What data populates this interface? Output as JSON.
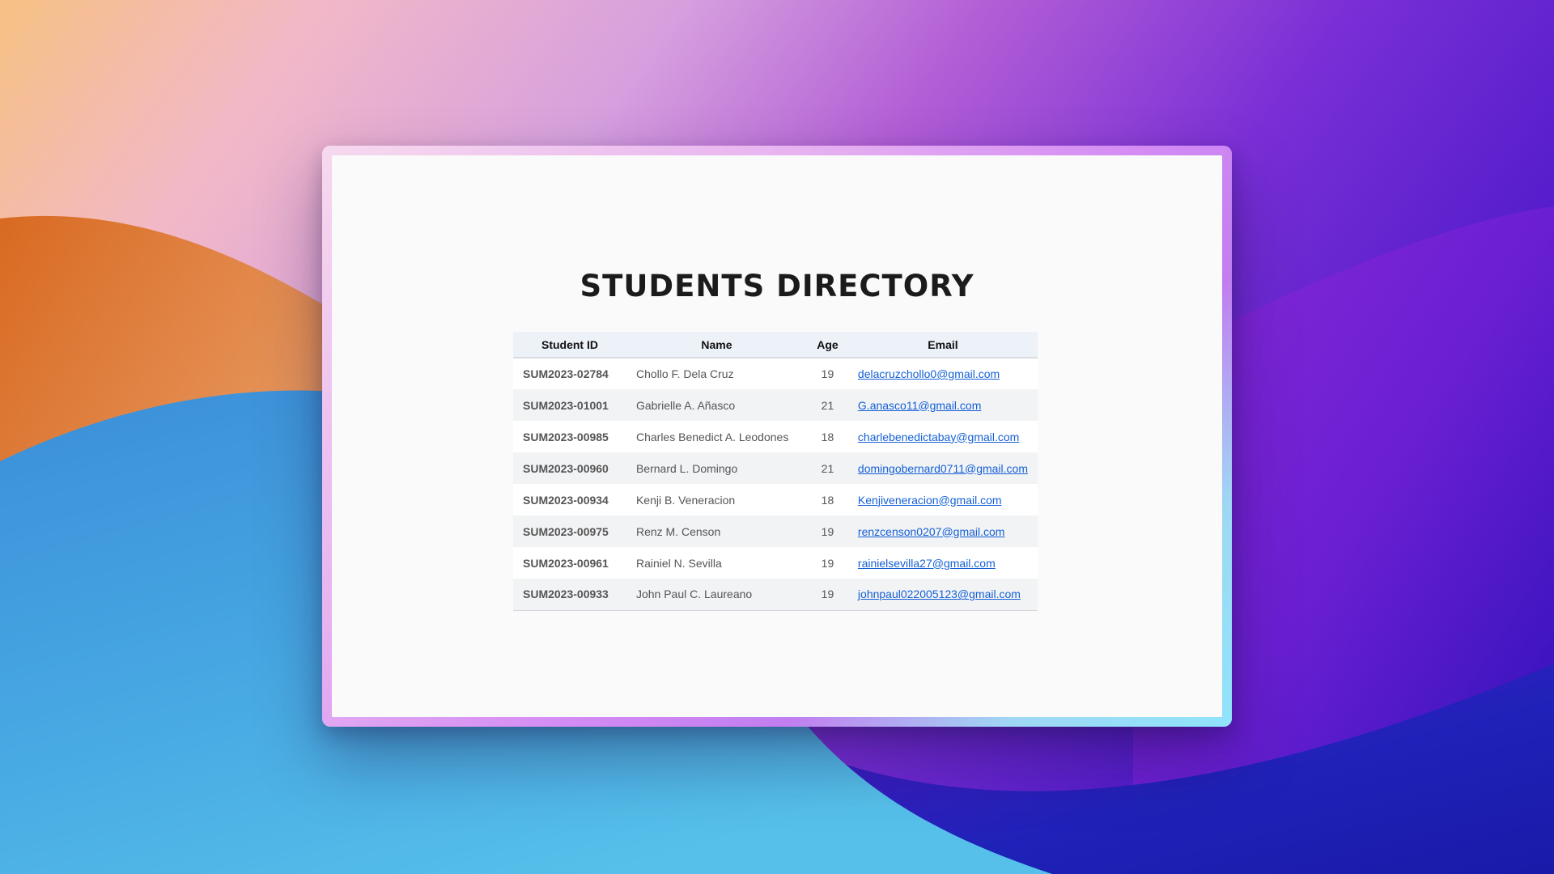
{
  "page": {
    "title": "STUDENTS DIRECTORY"
  },
  "table": {
    "headers": {
      "student_id": "Student ID",
      "name": "Name",
      "age": "Age",
      "email": "Email"
    },
    "rows": [
      {
        "student_id": "SUM2023-02784",
        "name": "Chollo F. Dela Cruz",
        "age": "19",
        "email": "delacruzchollo0@gmail.com"
      },
      {
        "student_id": "SUM2023-01001",
        "name": "Gabrielle A. Añasco",
        "age": "21",
        "email": "G.anasco11@gmail.com"
      },
      {
        "student_id": "SUM2023-00985",
        "name": "Charles Benedict A. Leodones",
        "age": "18",
        "email": "charlebenedictabay@gmail.com"
      },
      {
        "student_id": "SUM2023-00960",
        "name": "Bernard L. Domingo",
        "age": "21",
        "email": "domingobernard0711@gmail.com"
      },
      {
        "student_id": "SUM2023-00934",
        "name": "Kenji B. Veneracion",
        "age": "18",
        "email": "Kenjiveneracion@gmail.com"
      },
      {
        "student_id": "SUM2023-00975",
        "name": "Renz M. Censon",
        "age": "19",
        "email": "renzcenson0207@gmail.com"
      },
      {
        "student_id": "SUM2023-00961",
        "name": "Rainiel N. Sevilla",
        "age": "19",
        "email": "rainielsevilla27@gmail.com"
      },
      {
        "student_id": "SUM2023-00933",
        "name": "John Paul C. Laureano",
        "age": "19",
        "email": "johnpaul022005123@gmail.com"
      }
    ]
  },
  "colors": {
    "link": "#1460d6",
    "header_bg": "#edf1f8",
    "stripe_bg": "#f2f3f5",
    "title": "#1b1b1b"
  }
}
